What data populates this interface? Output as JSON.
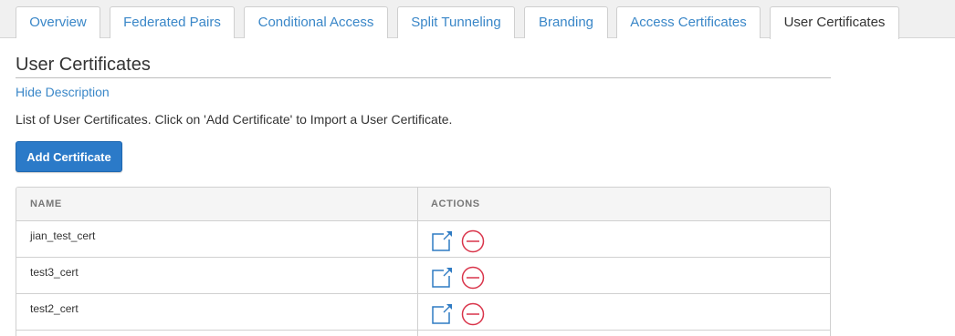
{
  "tabs": [
    {
      "label": "Overview",
      "active": false
    },
    {
      "label": "Federated Pairs",
      "active": false
    },
    {
      "label": "Conditional Access",
      "active": false
    },
    {
      "label": "Split Tunneling",
      "active": false
    },
    {
      "label": "Branding",
      "active": false
    },
    {
      "label": "Access Certificates",
      "active": false
    },
    {
      "label": "User Certificates",
      "active": true
    }
  ],
  "section": {
    "title": "User Certificates",
    "hide_description": "Hide Description",
    "description": "List of User Certificates. Click on 'Add Certificate' to Import a User Certificate.",
    "add_button": "Add Certificate"
  },
  "table": {
    "columns": [
      "NAME",
      "ACTIONS"
    ],
    "rows": [
      {
        "name": "jian_test_cert",
        "actions": [
          "edit-icon",
          "delete-icon"
        ]
      },
      {
        "name": "test3_cert",
        "actions": [
          "edit-icon",
          "delete-icon"
        ]
      },
      {
        "name": "test2_cert",
        "actions": [
          "edit-icon",
          "delete-icon"
        ]
      }
    ]
  },
  "colors": {
    "link": "#3a87c8",
    "primary_button": "#2b7ac8",
    "edit_icon": "#2f7bc3",
    "delete_icon": "#d9344a"
  }
}
